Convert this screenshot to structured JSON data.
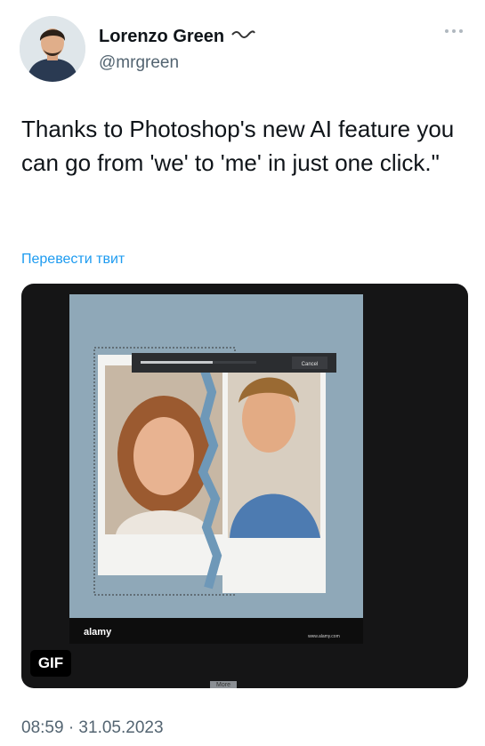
{
  "tweet": {
    "user_name": "Lorenzo Green",
    "handle": "@mrgreen",
    "text": "Thanks to Photoshop's new AI feature you can go from 'we' to 'me' in just one click.\"",
    "translate_link": "Перевести твит",
    "timestamp": "08:59 · 31.05.2023"
  },
  "media": {
    "gif_label": "GIF",
    "more_label": "More",
    "dialog_button": "Cancel",
    "watermark": "alamy",
    "watermark_url": "www.alamy.com",
    "progress": 0.62
  },
  "colors": {
    "link": "#1d9bf0",
    "secondary_text": "#536471",
    "media_bg": "#151516",
    "photo_bg": "#8fa8b8"
  },
  "icons": [
    "verified-icon",
    "more-options-icon",
    "avatar"
  ]
}
